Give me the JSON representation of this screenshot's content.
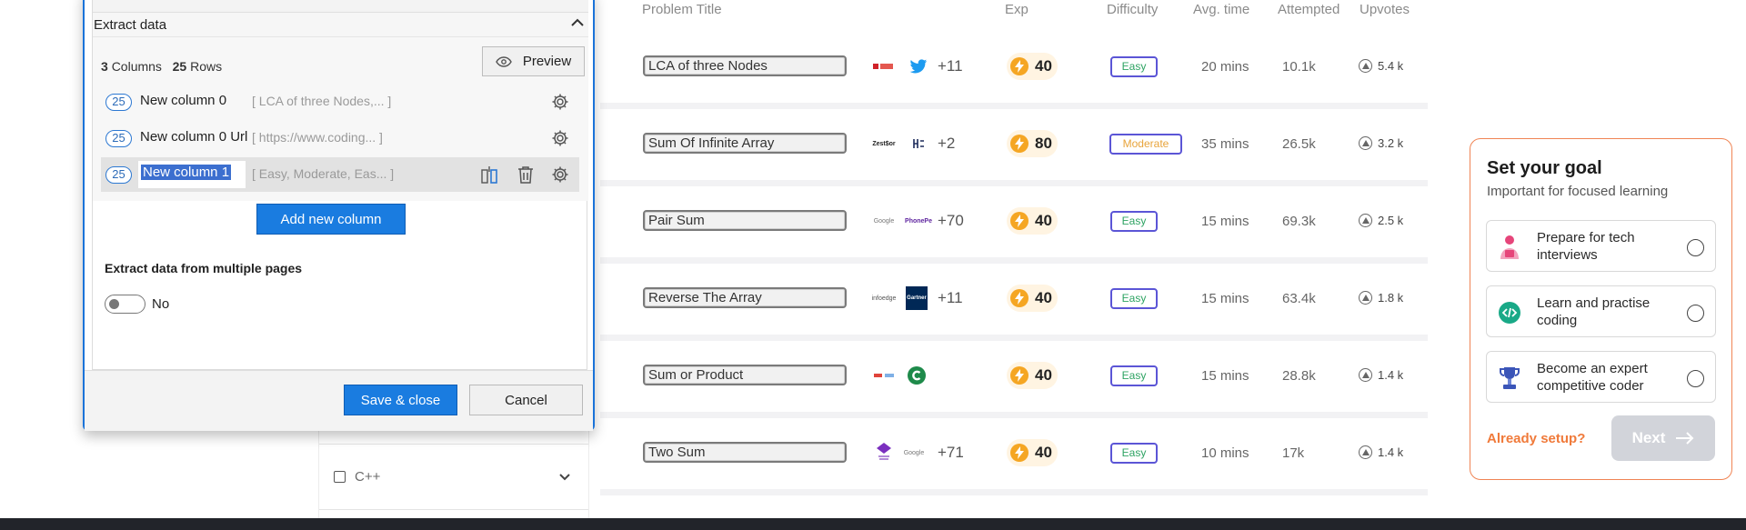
{
  "filters": {
    "language_item": "C++"
  },
  "table": {
    "headers": {
      "problem_title": "Problem Title",
      "exp": "Exp",
      "difficulty": "Difficulty",
      "avg_time": "Avg. time",
      "attempted": "Attempted",
      "upvotes": "Upvotes"
    },
    "rows": [
      {
        "title": "LCA of three Nodes",
        "companies": [
          "Company logo",
          "twitter-icon"
        ],
        "more": "+11",
        "exp": "40",
        "difficulty": "Easy",
        "avg_time": "20 mins",
        "attempted": "10.1k",
        "upvotes": "5.4 k"
      },
      {
        "title": "Sum Of Infinite Array",
        "companies": [
          "ZestMoney",
          "Hexaware"
        ],
        "more": "+2",
        "exp": "80",
        "difficulty": "Moderate",
        "avg_time": "35 mins",
        "attempted": "26.5k",
        "upvotes": "3.2 k"
      },
      {
        "title": "Pair Sum",
        "companies": [
          "Google",
          "Phonepe"
        ],
        "more": "+70",
        "exp": "40",
        "difficulty": "Easy",
        "avg_time": "15 mins",
        "attempted": "69.3k",
        "upvotes": "2.5 k"
      },
      {
        "title": "Reverse The Array",
        "companies": [
          "Infoedge",
          "Gartner"
        ],
        "more": "+11",
        "exp": "40",
        "difficulty": "Easy",
        "avg_time": "15 mins",
        "attempted": "63.4k",
        "upvotes": "1.8 k"
      },
      {
        "title": "Sum or Product",
        "companies": [
          "Company logo",
          "Company logo"
        ],
        "more": "",
        "exp": "40",
        "difficulty": "Easy",
        "avg_time": "15 mins",
        "attempted": "28.8k",
        "upvotes": "1.4 k"
      },
      {
        "title": "Two Sum",
        "companies": [
          "Company logo",
          "Google"
        ],
        "more": "+71",
        "exp": "40",
        "difficulty": "Easy",
        "avg_time": "10 mins",
        "attempted": "17k",
        "upvotes": "1.4 k"
      }
    ]
  },
  "goal": {
    "title": "Set your goal",
    "subtitle": "Important for focused learning",
    "options": [
      {
        "label": "Prepare for tech interviews",
        "icon": "interview-icon"
      },
      {
        "label": "Learn and practise coding",
        "icon": "code-icon"
      },
      {
        "label": "Become an expert competitive coder",
        "icon": "trophy-icon"
      }
    ],
    "already_setup": "Already setup?",
    "next": "Next"
  },
  "dialog": {
    "section_title": "Extract data",
    "columns_count": "3",
    "columns_label": "Columns",
    "rows_count": "25",
    "rows_label": "Rows",
    "preview_label": "Preview",
    "columns": [
      {
        "count": "25",
        "name": "New column 0",
        "preview": "[ LCA of three Nodes,... ]"
      },
      {
        "count": "25",
        "name": "New column 0 Url",
        "preview": "[ https://www.coding... ]"
      },
      {
        "count": "25",
        "name": "New column 1",
        "preview": "[ Easy, Moderate, Eas... ]"
      }
    ],
    "add_column_label": "Add new column",
    "multi_pages_title": "Extract data from multiple pages",
    "multi_pages_value": "No",
    "save_label": "Save & close",
    "cancel_label": "Cancel"
  },
  "colors": {
    "primary_blue": "#1a7ce0",
    "accent_orange": "#f07a3a",
    "difficulty_border": "#5b55d6",
    "easy_green": "#2ea363",
    "moderate_orange": "#e8a43b"
  }
}
